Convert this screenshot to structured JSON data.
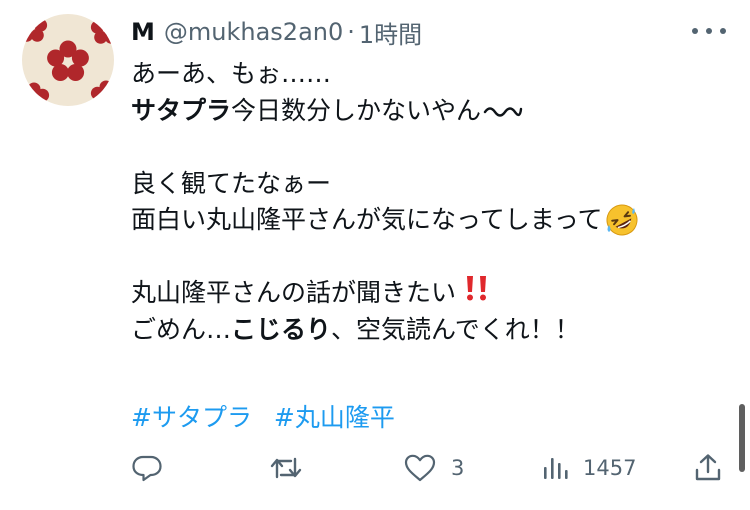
{
  "tweet": {
    "author": {
      "display_name": "M",
      "handle": "@mukhas2an0",
      "separator": "·",
      "time": "1時間"
    },
    "body": {
      "line1": "あーあ、もぉ……",
      "line2_bold": "サタプラ",
      "line2_rest": "今日数分しかないやん",
      "line3": "良く観てたなぁー",
      "line4": "面白い丸山隆平さんが気になってしまって",
      "line5": "丸山隆平さんの話が聞きたい",
      "line6_a": "ごめん…",
      "line6_bold": "こじるり",
      "line6_c": "、空気読んでくれ！！"
    },
    "hashtags": [
      "#サタプラ",
      "#丸山隆平"
    ],
    "actions": {
      "reply_count": "",
      "retweet_count": "",
      "like_count": "3",
      "views_count": "1457"
    },
    "icons": {
      "more": "more-dots-icon",
      "reply": "reply-icon",
      "retweet": "retweet-icon",
      "like": "heart-icon",
      "views": "views-icon",
      "share": "share-icon",
      "wave": "wavy-dash-emoji",
      "rofl": "rolling-on-floor-laughing-emoji",
      "bang": "double-exclamation-emoji"
    },
    "colors": {
      "text": "#0f1419",
      "muted": "#536471",
      "link": "#1d9bf0",
      "avatar_bg": "#f0e6d4",
      "avatar_pattern": "#b0272b"
    }
  }
}
